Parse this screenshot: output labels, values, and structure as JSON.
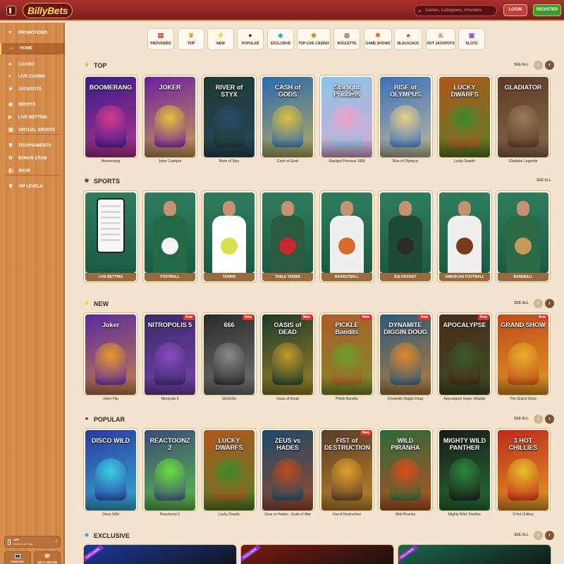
{
  "header": {
    "logo": "BillyBets",
    "search_placeholder": "Games, Categories, Providers",
    "login": "LOGIN",
    "register": "REGISTER"
  },
  "sidebar": {
    "items": [
      {
        "label": "PROMOTIONS",
        "icon": "gift-icon"
      },
      {
        "label": "HOME",
        "icon": "home-icon",
        "active": true
      },
      {
        "label": "CASINO",
        "icon": "slot-icon"
      },
      {
        "label": "LIVE CASINO",
        "icon": "cards-icon"
      },
      {
        "label": "JACKPOTS",
        "icon": "jackpot-icon"
      },
      {
        "label": "SPORTS",
        "icon": "ball-icon"
      },
      {
        "label": "LIVE BETTING",
        "icon": "live-icon"
      },
      {
        "label": "VIRTUAL SPORTS",
        "icon": "virtual-icon"
      },
      {
        "label": "TOURNAMENTS",
        "icon": "trophy-icon"
      },
      {
        "label": "BONUS CRAB",
        "icon": "crab-icon"
      },
      {
        "label": "SHOP",
        "icon": "cart-icon"
      },
      {
        "label": "VIP LEVELS",
        "icon": "crown-icon"
      }
    ],
    "app": {
      "title": "APP",
      "subtitle": "Install and Play"
    },
    "language": "ENGLISH",
    "help": "HELP CENTRE"
  },
  "categories": [
    {
      "label": "PROVIDERS",
      "color": "#c0392b",
      "glyph": "▤"
    },
    {
      "label": "TOP",
      "color": "#e0a020",
      "glyph": "♛"
    },
    {
      "label": "NEW",
      "color": "#e8b020",
      "glyph": "⚡"
    },
    {
      "label": "POPULAR",
      "color": "#333333",
      "glyph": "●"
    },
    {
      "label": "EXCLUSIVE",
      "color": "#2fa3e6",
      "glyph": "◆"
    },
    {
      "label": "TOP LIVE CASINO",
      "color": "#e08a1c",
      "glyph": "♚"
    },
    {
      "label": "ROULETTE",
      "color": "#6b3a1c",
      "glyph": "◎"
    },
    {
      "label": "GAME SHOWS",
      "color": "#e0701c",
      "glyph": "✹"
    },
    {
      "label": "BLACKJACK",
      "color": "#c8283c",
      "glyph": "♠"
    },
    {
      "label": "HOT JACKPOTS",
      "color": "#e04a1c",
      "glyph": "♨"
    },
    {
      "label": "SLOTS",
      "color": "#9a4ad8",
      "glyph": "▣"
    }
  ],
  "sections": {
    "top": {
      "title": "TOP",
      "see_all": "SEE ALL",
      "games": [
        {
          "name": "Boomerang",
          "art": "BOOMERANG",
          "bg": "#3a1d8a",
          "accent": "#d63a8a"
        },
        {
          "name": "Joker Cashpot",
          "art": "JOKER",
          "bg": "#6a1fa0",
          "accent": "#e8c23a"
        },
        {
          "name": "River of Styx",
          "art": "RIVER of STYX",
          "bg": "#1e3a32",
          "accent": "#2a4a6a"
        },
        {
          "name": "Cash of Gods",
          "art": "CASH of GODS",
          "bg": "#2a6ab0",
          "accent": "#e0c040"
        },
        {
          "name": "Starlight Princess 1000",
          "art": "Starlight Princess",
          "bg": "#8ac4ea",
          "accent": "#f0a0c8"
        },
        {
          "name": "Rise of Olympus",
          "art": "RISE of OLYMPUS",
          "bg": "#3a70c0",
          "accent": "#e8d08a"
        },
        {
          "name": "Lucky Dwarfs",
          "art": "LUCKY DWARFS",
          "bg": "#b0561c",
          "accent": "#3a8a2a"
        },
        {
          "name": "Gladiator Legends",
          "art": "GLADIATOR",
          "bg": "#5a3a24",
          "accent": "#9a7a5a"
        }
      ]
    },
    "sports": {
      "title": "SPORTS",
      "see_all": "SEE ALL",
      "items": [
        {
          "label": "LIVE BETTING",
          "shirt": "#2e7d55",
          "prop": "#ffffff"
        },
        {
          "label": "FOOTBALL",
          "shirt": "#246848",
          "prop": "#f5f5f5"
        },
        {
          "label": "TENNIS",
          "shirt": "#ffffff",
          "prop": "#d8e04a"
        },
        {
          "label": "TABLE TENNIS",
          "shirt": "#2a5a40",
          "prop": "#c8282c"
        },
        {
          "label": "BASKETBALL",
          "shirt": "#f0f0f0",
          "prop": "#d86a2a"
        },
        {
          "label": "ICE HOCKEY",
          "shirt": "#1e4a36",
          "prop": "#2a2a2a"
        },
        {
          "label": "AMERICAN FOOTBALL",
          "shirt": "#f0f0f0",
          "prop": "#7a3a1c"
        },
        {
          "label": "BASEBALL",
          "shirt": "#2a6a46",
          "prop": "#c89a5a"
        }
      ]
    },
    "new": {
      "title": "NEW",
      "see_all": "SEE ALL",
      "new_badge": "New",
      "games": [
        {
          "name": "Joker Flip",
          "art": "Joker",
          "bg": "#5a2aa0",
          "accent": "#e89a2a",
          "badge": false
        },
        {
          "name": "Nitropolis 5",
          "art": "NITROPOLIS 5",
          "bg": "#3a2a6a",
          "accent": "#8a4ac0",
          "badge": true
        },
        {
          "name": "SixSixSix",
          "art": "666",
          "bg": "#2a2a2a",
          "accent": "#8a8a8a",
          "badge": true
        },
        {
          "name": "Oasis of Dead",
          "art": "OASIS of DEAD",
          "bg": "#1e3a2a",
          "accent": "#c09a2a",
          "badge": true
        },
        {
          "name": "Pickle Bandits",
          "art": "PICKLE Bandits",
          "bg": "#b05a2a",
          "accent": "#6aa02a",
          "badge": true
        },
        {
          "name": "Dynamite Diggin Doug",
          "art": "DYNAMITE DIGGIN DOUG",
          "bg": "#2a5a7a",
          "accent": "#e08a2a",
          "badge": true
        },
        {
          "name": "Apocalypse Super xNudge",
          "art": "APOCALYPSE",
          "bg": "#4a2a1a",
          "accent": "#3a5a2a",
          "badge": true
        },
        {
          "name": "The Grand Show",
          "art": "GRAND SHOW",
          "bg": "#c04a1a",
          "accent": "#e8b02a",
          "badge": true
        }
      ]
    },
    "popular": {
      "title": "POPULAR",
      "see_all": "SEE ALL",
      "new_badge": "New",
      "games": [
        {
          "name": "Disco Wild",
          "art": "DISCO WILD",
          "bg": "#2a3aa0",
          "accent": "#3ad0e0",
          "badge": false
        },
        {
          "name": "Reactoonz 2",
          "art": "REACTOONZ 2",
          "bg": "#3a4a7a",
          "accent": "#6ae03a",
          "badge": false
        },
        {
          "name": "Lucky Dwarfs",
          "art": "LUCKY DWARFS",
          "bg": "#b0561c",
          "accent": "#3a8a2a",
          "badge": false
        },
        {
          "name": "Zeus vs Hades - Gods of War",
          "art": "ZEUS vs HADES",
          "bg": "#1a4a6a",
          "accent": "#c04a1a",
          "badge": false
        },
        {
          "name": "Fist of Destruction",
          "art": "FIST of DESTRUCTION",
          "bg": "#5a3a2a",
          "accent": "#e0a02a",
          "badge": true
        },
        {
          "name": "Wild Piranha",
          "art": "WILD PIRANHA",
          "bg": "#2a6a3a",
          "accent": "#e04a1a",
          "badge": false
        },
        {
          "name": "Mighty Wild: Panther",
          "art": "MIGHTY WILD PANTHER",
          "bg": "#1a1a1a",
          "accent": "#2a8a3a",
          "badge": false
        },
        {
          "name": "3 Hot Chillies",
          "art": "3 HOT CHILLIES",
          "bg": "#c0281a",
          "accent": "#e8c02a",
          "badge": false
        }
      ]
    },
    "exclusive": {
      "title": "EXCLUSIVE",
      "see_all": "SEE ALL",
      "ribbon": "EXCLUSIVE",
      "tiles": [
        {
          "bg": "#1a3a9a"
        },
        {
          "bg": "#7a1a10"
        },
        {
          "bg": "#1a6a4a"
        }
      ]
    }
  }
}
